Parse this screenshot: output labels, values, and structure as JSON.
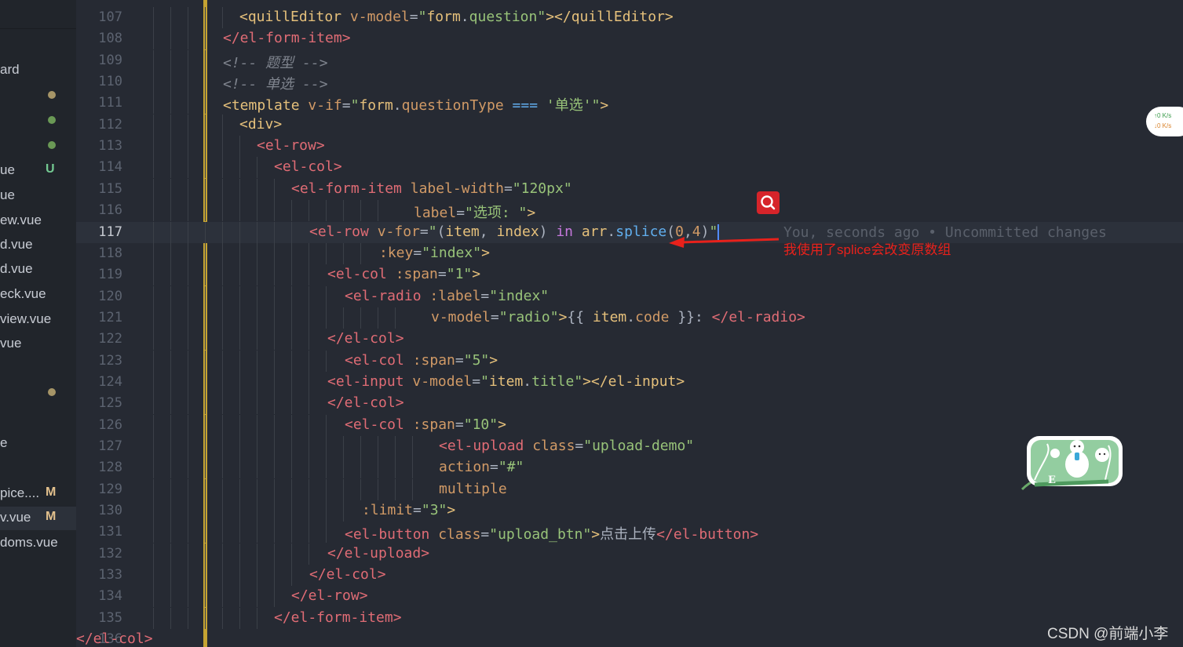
{
  "sidebar": {
    "items": [
      {
        "name": "ard",
        "badge": "",
        "dot": ""
      },
      {
        "name": "",
        "badge": "",
        "dot": "#a69567"
      },
      {
        "name": "",
        "badge": "",
        "dot": "#6a9955"
      },
      {
        "name": "",
        "badge": "",
        "dot": "#6a9955"
      },
      {
        "name": "ue",
        "badge": "U",
        "dot": ""
      },
      {
        "name": "ue",
        "badge": "",
        "dot": ""
      },
      {
        "name": "ew.vue",
        "badge": "",
        "dot": ""
      },
      {
        "name": "d.vue",
        "badge": "",
        "dot": ""
      },
      {
        "name": "d.vue",
        "badge": "",
        "dot": ""
      },
      {
        "name": "eck.vue",
        "badge": "",
        "dot": ""
      },
      {
        "name": "view.vue",
        "badge": "",
        "dot": ""
      },
      {
        "name": "vue",
        "badge": "",
        "dot": ""
      },
      {
        "name": "",
        "badge": "",
        "dot": "#a69567"
      },
      {
        "name": "e",
        "badge": "",
        "dot": ""
      },
      {
        "name": "",
        "badge": "",
        "dot": ""
      },
      {
        "name": "pice....",
        "badge": "M",
        "dot": ""
      },
      {
        "name": "v.vue",
        "badge": "M",
        "dot": ""
      },
      {
        "name": "doms.vue",
        "badge": "",
        "dot": ""
      }
    ]
  },
  "editor": {
    "current_line": 117,
    "lines": [
      {
        "n": 107,
        "tokens": [
          [
            "tag",
            "<quillEditor"
          ],
          [
            "punc",
            " "
          ],
          [
            "attr",
            "v-model"
          ],
          [
            "punc",
            "="
          ],
          [
            "str",
            "\""
          ],
          [
            "var",
            "form"
          ],
          [
            "punc",
            "."
          ],
          [
            "str",
            "question"
          ],
          [
            "str",
            "\""
          ],
          [
            "tag",
            "></quillEditor>"
          ]
        ]
      },
      {
        "n": 108,
        "tokens": [
          [
            "tag",
            "</el-form-item>"
          ]
        ]
      },
      {
        "n": 109,
        "tokens": [
          [
            "cmt",
            "<!-- 题型 -->"
          ]
        ]
      },
      {
        "n": 110,
        "tokens": [
          [
            "cmt",
            "<!-- 单选 -->"
          ]
        ]
      },
      {
        "n": 111,
        "tokens": [
          [
            "tag",
            "<template"
          ],
          [
            "punc",
            " "
          ],
          [
            "attr",
            "v-if"
          ],
          [
            "punc",
            "="
          ],
          [
            "str",
            "\""
          ],
          [
            "var",
            "form"
          ],
          [
            "punc",
            "."
          ],
          [
            "attr",
            "questionType"
          ],
          [
            "punc",
            " "
          ],
          [
            "fn",
            "==="
          ],
          [
            "punc",
            " "
          ],
          [
            "str",
            "'单选'"
          ],
          [
            "str",
            "\""
          ],
          [
            "tag",
            ">"
          ]
        ]
      },
      {
        "n": 112,
        "tokens": [
          [
            "tag",
            "<div>"
          ]
        ]
      },
      {
        "n": 113,
        "tokens": [
          [
            "tag",
            "<el-row>"
          ]
        ]
      },
      {
        "n": 114,
        "tokens": [
          [
            "tag",
            "<el-col>"
          ]
        ]
      },
      {
        "n": 115,
        "tokens": [
          [
            "tag",
            "<el-form-item"
          ],
          [
            "punc",
            " "
          ],
          [
            "attr",
            "label-width"
          ],
          [
            "punc",
            "="
          ],
          [
            "str",
            "\"120px\""
          ]
        ]
      },
      {
        "n": 116,
        "tokens": [
          [
            "attr",
            "label"
          ],
          [
            "punc",
            "="
          ],
          [
            "str",
            "\"选项: \""
          ],
          [
            "tag",
            ">"
          ]
        ]
      },
      {
        "n": 117,
        "tokens": [
          [
            "tag",
            "<el-row"
          ],
          [
            "punc",
            " "
          ],
          [
            "attr",
            "v-for"
          ],
          [
            "punc",
            "="
          ],
          [
            "str",
            "\""
          ],
          [
            "punc",
            "("
          ],
          [
            "var",
            "item"
          ],
          [
            "punc",
            ", "
          ],
          [
            "var",
            "index"
          ],
          [
            "punc",
            ") "
          ],
          [
            "kw",
            "in"
          ],
          [
            "punc",
            " "
          ],
          [
            "var",
            "arr"
          ],
          [
            "punc",
            "."
          ],
          [
            "fn",
            "splice"
          ],
          [
            "punc",
            "("
          ],
          [
            "attr",
            "0"
          ],
          [
            "punc",
            ","
          ],
          [
            "attr",
            "4"
          ],
          [
            "punc",
            ")"
          ],
          [
            "str",
            "\""
          ]
        ]
      },
      {
        "n": 118,
        "tokens": [
          [
            "attr",
            ":key"
          ],
          [
            "punc",
            "="
          ],
          [
            "str",
            "\"index\""
          ],
          [
            "tag",
            ">"
          ]
        ]
      },
      {
        "n": 119,
        "tokens": [
          [
            "tag",
            "<el-col"
          ],
          [
            "punc",
            " "
          ],
          [
            "attr",
            ":span"
          ],
          [
            "punc",
            "="
          ],
          [
            "str",
            "\"1\""
          ],
          [
            "tag",
            ">"
          ]
        ]
      },
      {
        "n": 120,
        "tokens": [
          [
            "tag",
            "<el-radio"
          ],
          [
            "punc",
            " "
          ],
          [
            "attr",
            ":label"
          ],
          [
            "punc",
            "="
          ],
          [
            "str",
            "\"index\""
          ]
        ]
      },
      {
        "n": 121,
        "tokens": [
          [
            "attr",
            "v-model"
          ],
          [
            "punc",
            "="
          ],
          [
            "str",
            "\"radio\""
          ],
          [
            "tag",
            ">"
          ],
          [
            "punc",
            "{{ "
          ],
          [
            "var",
            "item"
          ],
          [
            "punc",
            "."
          ],
          [
            "attr",
            "code"
          ],
          [
            "punc",
            " }}: "
          ],
          [
            "tag",
            "</el-radio>"
          ]
        ]
      },
      {
        "n": 122,
        "tokens": [
          [
            "tag",
            "</el-col>"
          ]
        ]
      },
      {
        "n": 123,
        "tokens": [
          [
            "tag",
            "<el-col"
          ],
          [
            "punc",
            " "
          ],
          [
            "attr",
            ":span"
          ],
          [
            "punc",
            "="
          ],
          [
            "str",
            "\"5\""
          ],
          [
            "tag",
            ">"
          ]
        ]
      },
      {
        "n": 124,
        "tokens": [
          [
            "tag",
            "<el-input"
          ],
          [
            "punc",
            " "
          ],
          [
            "attr",
            "v-model"
          ],
          [
            "punc",
            "="
          ],
          [
            "str",
            "\""
          ],
          [
            "var",
            "item"
          ],
          [
            "punc",
            "."
          ],
          [
            "str",
            "title"
          ],
          [
            "str",
            "\""
          ],
          [
            "tag",
            "></el-input>"
          ]
        ]
      },
      {
        "n": 125,
        "tokens": [
          [
            "tag",
            "</el-col>"
          ]
        ]
      },
      {
        "n": 126,
        "tokens": [
          [
            "tag",
            "<el-col"
          ],
          [
            "punc",
            " "
          ],
          [
            "attr",
            ":span"
          ],
          [
            "punc",
            "="
          ],
          [
            "str",
            "\"10\""
          ],
          [
            "tag",
            ">"
          ]
        ]
      },
      {
        "n": 127,
        "tokens": [
          [
            "tag",
            "<el-upload"
          ],
          [
            "punc",
            " "
          ],
          [
            "attr",
            "class"
          ],
          [
            "punc",
            "="
          ],
          [
            "str",
            "\"upload-demo\""
          ]
        ]
      },
      {
        "n": 128,
        "tokens": [
          [
            "attr",
            "action"
          ],
          [
            "punc",
            "="
          ],
          [
            "str",
            "\"#\""
          ]
        ]
      },
      {
        "n": 129,
        "tokens": [
          [
            "attr",
            "multiple"
          ]
        ]
      },
      {
        "n": 130,
        "tokens": [
          [
            "attr",
            ":limit"
          ],
          [
            "punc",
            "="
          ],
          [
            "str",
            "\"3\""
          ],
          [
            "tag",
            ">"
          ]
        ]
      },
      {
        "n": 131,
        "tokens": [
          [
            "tag",
            "<el-button"
          ],
          [
            "punc",
            " "
          ],
          [
            "attr",
            "class"
          ],
          [
            "punc",
            "="
          ],
          [
            "str",
            "\"upload_btn\""
          ],
          [
            "tag",
            ">"
          ],
          [
            "punc",
            "点击上传"
          ],
          [
            "tag",
            "</el-button>"
          ]
        ]
      },
      {
        "n": 132,
        "tokens": [
          [
            "tag",
            "</el-upload>"
          ]
        ]
      },
      {
        "n": 133,
        "tokens": [
          [
            "tag",
            "</el-col>"
          ]
        ]
      },
      {
        "n": 134,
        "tokens": [
          [
            "tag",
            "</el-row>"
          ]
        ]
      },
      {
        "n": 135,
        "tokens": [
          [
            "tag",
            "</el-form-item>"
          ]
        ]
      },
      {
        "n": 136,
        "tokens": [
          [
            "tag",
            "</el-col>"
          ]
        ]
      }
    ],
    "blame": "You, seconds ago • Uncommitted changes",
    "annotation": "我使用了splice会改变原数组"
  },
  "net_speed": {
    "up": "↑0  K/s",
    "down": "↓0  K/s"
  },
  "watermark": "CSDN @前端小李",
  "colors": {
    "tag": "#e5c07b",
    "string": "#98c379",
    "attribute": "#d19a66",
    "keyword": "#c678dd",
    "function": "#61afef",
    "annotation": "#e8211b",
    "git_bar": "#c5a332"
  },
  "icons": [
    "search-icon",
    "mascot-sticker"
  ]
}
